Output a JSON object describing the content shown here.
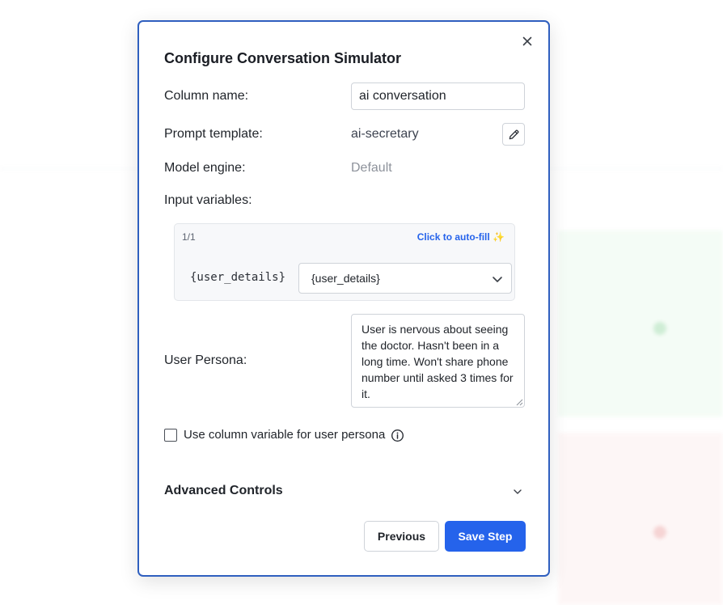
{
  "modal": {
    "title": "Configure Conversation Simulator",
    "column_name_label": "Column name:",
    "column_name_value": "ai conversation",
    "prompt_template_label": "Prompt template:",
    "prompt_template_value": "ai-secretary",
    "model_engine_label": "Model engine:",
    "model_engine_value": "Default",
    "input_variables_label": "Input variables:",
    "variables": {
      "count": "1/1",
      "autofill_label": "Click to auto-fill",
      "autofill_icon": "sparkle-icon",
      "items": [
        {
          "name": "{user_details}",
          "selected": "{user_details}"
        }
      ]
    },
    "user_persona_label": "User Persona:",
    "user_persona_value": "User is nervous about seeing the doctor. Hasn't been in a long time. Won't share phone number until asked 3 times for it.",
    "checkbox_label": "Use column variable for user persona",
    "checkbox_checked": false,
    "advanced_label": "Advanced Controls",
    "previous_label": "Previous",
    "save_label": "Save Step"
  },
  "colors": {
    "accent": "#2563eb",
    "modal_border": "#2f5fbf",
    "muted_value": "#8d929b"
  }
}
